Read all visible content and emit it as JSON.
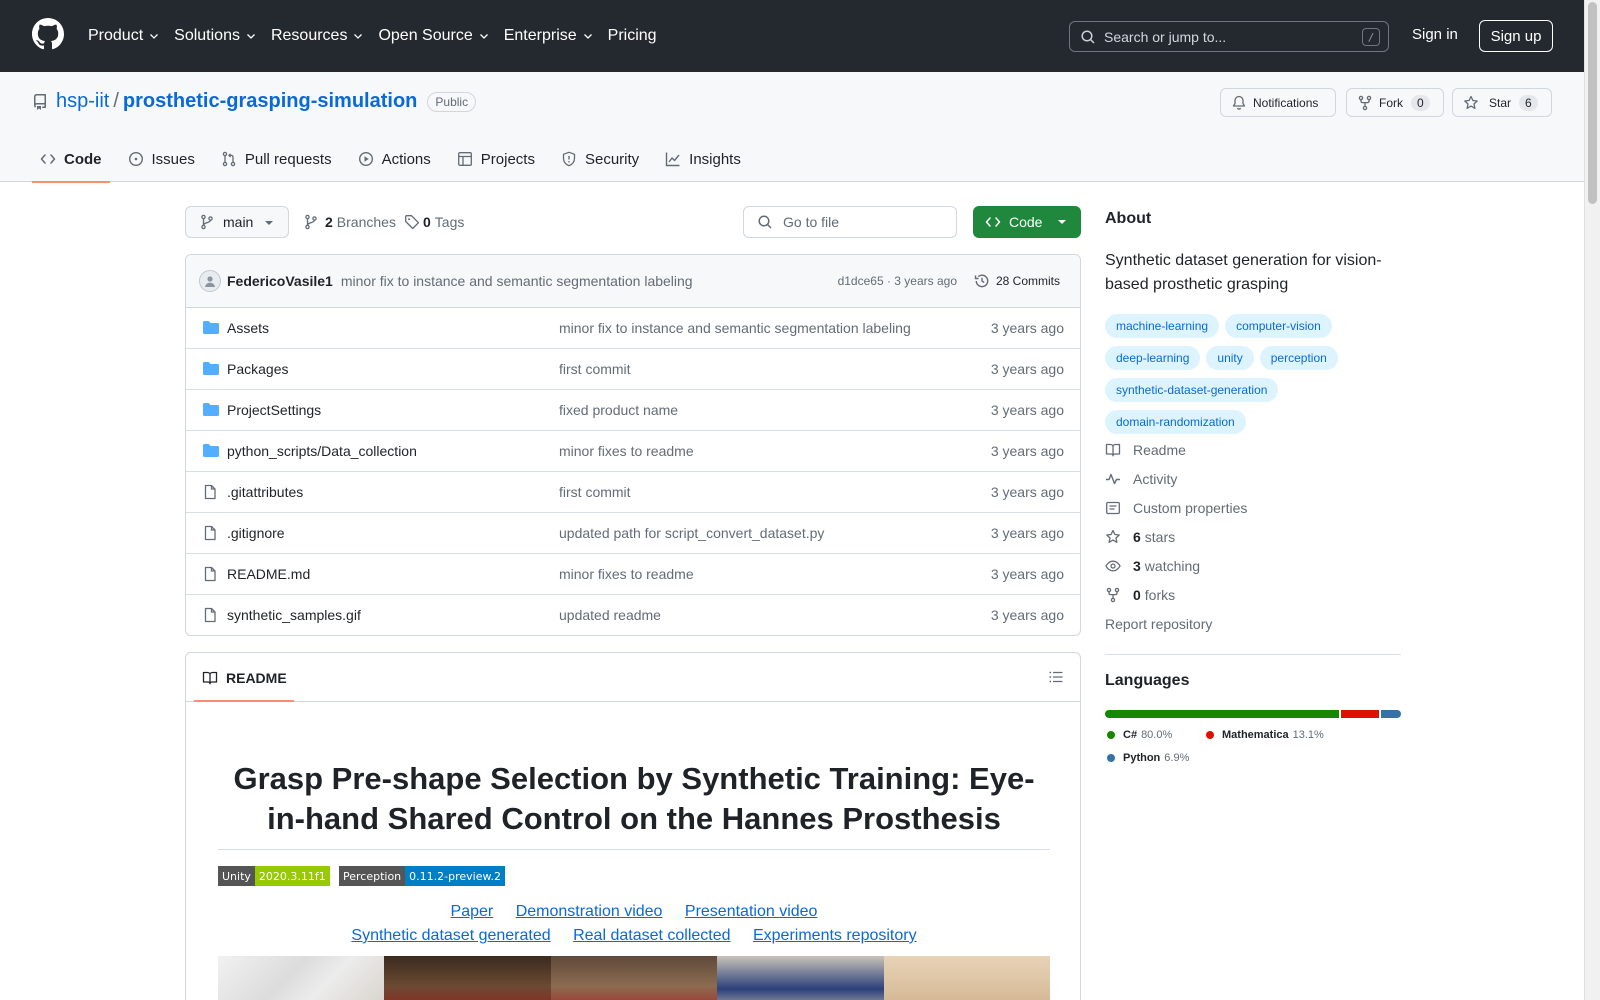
{
  "header": {
    "nav": [
      {
        "label": "Product",
        "dropdown": true
      },
      {
        "label": "Solutions",
        "dropdown": true
      },
      {
        "label": "Resources",
        "dropdown": true
      },
      {
        "label": "Open Source",
        "dropdown": true
      },
      {
        "label": "Enterprise",
        "dropdown": true
      },
      {
        "label": "Pricing",
        "dropdown": false
      }
    ],
    "search_placeholder": "Search or jump to...",
    "search_shortcut": "/",
    "signin": "Sign in",
    "signup": "Sign up"
  },
  "repo": {
    "owner": "hsp-iit",
    "separator": "/",
    "name": "prosthetic-grasping-simulation",
    "visibility": "Public",
    "notifications": "Notifications",
    "fork_label": "Fork",
    "fork_count": "0",
    "star_label": "Star",
    "star_count": "6"
  },
  "tabs": [
    {
      "label": "Code",
      "icon": "code-icon",
      "active": true
    },
    {
      "label": "Issues",
      "icon": "issue-icon"
    },
    {
      "label": "Pull requests",
      "icon": "pull-request-icon"
    },
    {
      "label": "Actions",
      "icon": "play-icon"
    },
    {
      "label": "Projects",
      "icon": "table-icon"
    },
    {
      "label": "Security",
      "icon": "shield-icon"
    },
    {
      "label": "Insights",
      "icon": "graph-icon"
    }
  ],
  "toolbar": {
    "branch": "main",
    "branches_count": "2",
    "branches_label": "Branches",
    "tags_count": "0",
    "tags_label": "Tags",
    "goto_placeholder": "Go to file",
    "code_button": "Code"
  },
  "latest_commit": {
    "author": "FedericoVasile1",
    "message": "minor fix to instance and semantic segmentation labeling",
    "hash_age": "d1dce65 · 3 years ago",
    "commits": "28 Commits"
  },
  "files": [
    {
      "name": "Assets",
      "type": "dir",
      "message": "minor fix to instance and semantic segmentation labeling",
      "age": "3 years ago"
    },
    {
      "name": "Packages",
      "type": "dir",
      "message": "first commit",
      "age": "3 years ago"
    },
    {
      "name": "ProjectSettings",
      "type": "dir",
      "message": "fixed product name",
      "age": "3 years ago"
    },
    {
      "name": "python_scripts/Data_collection",
      "type": "dir",
      "message": "minor fixes to readme",
      "age": "3 years ago"
    },
    {
      "name": ".gitattributes",
      "type": "file",
      "message": "first commit",
      "age": "3 years ago"
    },
    {
      "name": ".gitignore",
      "type": "file",
      "message": "updated path for script_convert_dataset.py",
      "age": "3 years ago"
    },
    {
      "name": "README.md",
      "type": "file",
      "message": "minor fixes to readme",
      "age": "3 years ago"
    },
    {
      "name": "synthetic_samples.gif",
      "type": "file",
      "message": "updated readme",
      "age": "3 years ago"
    }
  ],
  "readme": {
    "tab_label": "README",
    "title": "Grasp Pre-shape Selection by Synthetic Training: Eye-in-hand Shared Control on the Hannes Prosthesis",
    "badges": [
      {
        "key": "Unity",
        "value": "2020.3.11f1",
        "color": "#97ca00"
      },
      {
        "key": "Perception",
        "value": "0.11.2-preview.2",
        "color": "#007ec6"
      }
    ],
    "links_row1": [
      "Paper",
      "Demonstration video",
      "Presentation video"
    ],
    "links_row2": [
      "Synthetic dataset generated",
      "Real dataset collected",
      "Experiments repository"
    ]
  },
  "about": {
    "heading": "About",
    "description": "Synthetic dataset generation for vision-based prosthetic grasping",
    "topics": [
      "machine-learning",
      "computer-vision",
      "deep-learning",
      "unity",
      "perception",
      "synthetic-dataset-generation",
      "domain-randomization"
    ],
    "readme": "Readme",
    "activity": "Activity",
    "custom_properties": "Custom properties",
    "stars_count": "6",
    "stars_label": "stars",
    "watching_count": "3",
    "watching_label": "watching",
    "forks_count": "0",
    "forks_label": "forks",
    "report": "Report repository"
  },
  "languages": {
    "heading": "Languages",
    "items": [
      {
        "name": "C#",
        "percent": "80.0%",
        "value": 80.0,
        "color": "#178600"
      },
      {
        "name": "Mathematica",
        "percent": "13.1%",
        "value": 13.1,
        "color": "#dd1100"
      },
      {
        "name": "Python",
        "percent": "6.9%",
        "value": 6.9,
        "color": "#3572A5"
      }
    ]
  },
  "colors": {
    "header_bg": "#24292f",
    "link": "#0969da",
    "primary_button": "#1f883d",
    "active_tab_underline": "#fd8c73"
  }
}
